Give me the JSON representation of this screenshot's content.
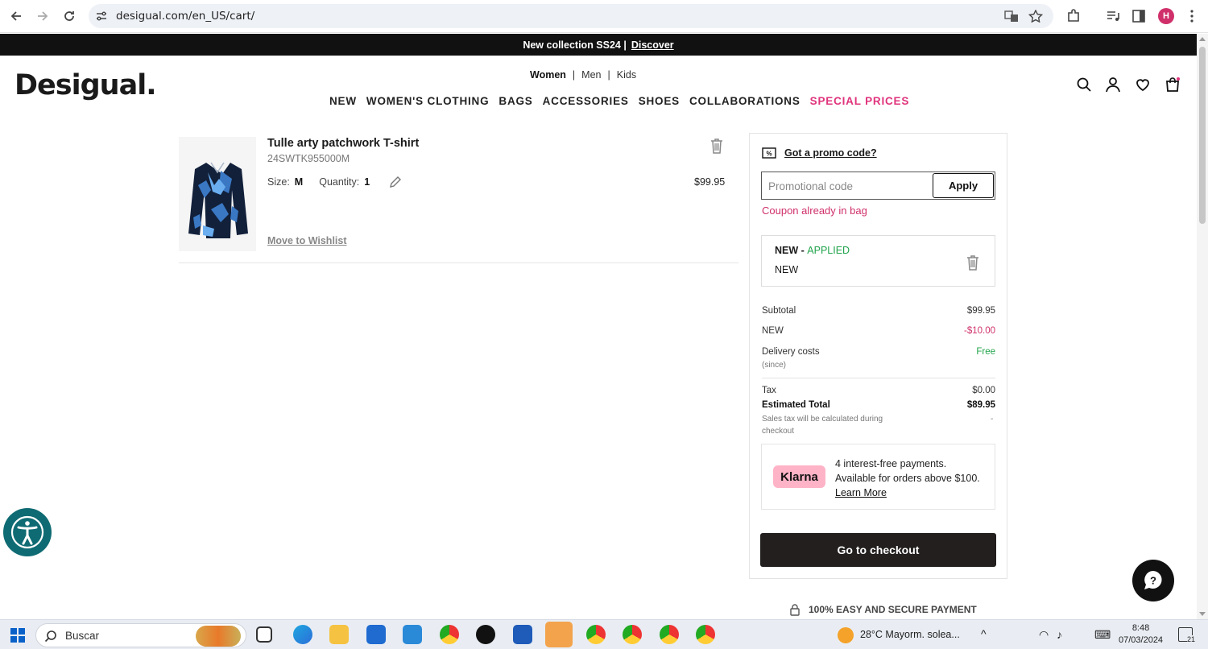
{
  "browser": {
    "url": "desigual.com/en_US/cart/",
    "profile_initial": "H"
  },
  "promo_bar": {
    "text": "New collection SS24 |",
    "link": "Discover"
  },
  "header": {
    "logo": "Desigual.",
    "gender_tabs": [
      {
        "label": "Women",
        "active": true
      },
      {
        "label": "Men",
        "active": false
      },
      {
        "label": "Kids",
        "active": false
      }
    ],
    "nav_items": [
      "NEW",
      "WOMEN'S CLOTHING",
      "BAGS",
      "ACCESSORIES",
      "SHOES",
      "COLLABORATIONS",
      "SPECIAL PRICES"
    ]
  },
  "cart_item": {
    "name": "Tulle arty patchwork T-shirt",
    "sku": "24SWTK955000M",
    "size_label": "Size:",
    "size_value": "M",
    "quantity_label": "Quantity:",
    "quantity_value": "1",
    "price": "$99.95",
    "wishlist_link": "Move to Wishlist"
  },
  "summary": {
    "promo_title": "Got a promo code?",
    "promo_placeholder": "Promotional code",
    "apply_label": "Apply",
    "coupon_message": "Coupon already in bag",
    "coupon_code": "NEW",
    "coupon_separator": " - ",
    "coupon_status": "APPLIED",
    "coupon_subtitle": "NEW",
    "subtotal_label": "Subtotal",
    "subtotal_value": "$99.95",
    "discount_label": "NEW",
    "discount_value": "-$10.00",
    "delivery_label": "Delivery costs",
    "delivery_note": "(since)",
    "delivery_value": "Free",
    "tax_label": "Tax",
    "tax_value": "$0.00",
    "total_label": "Estimated Total",
    "total_value": "$89.95",
    "total_note": "Sales tax will be calculated during checkout",
    "total_note_dash": "-",
    "klarna_logo": "Klarna",
    "klarna_line1": "4 interest-free payments.",
    "klarna_line2": "Available for orders above $100.",
    "klarna_link": "Learn More",
    "checkout_label": "Go to checkout",
    "secure_label": "100% EASY AND SECURE PAYMENT"
  },
  "taskbar": {
    "search_placeholder": "Buscar",
    "weather": "28°C  Mayorm. solea...",
    "time": "8:48",
    "date": "07/03/2024",
    "notif_count": "21"
  },
  "colors": {
    "accent_pink": "#e0337c",
    "applied_green": "#1fa34a",
    "checkout_bg": "#231f1f",
    "accessibility_teal": "#0e6b73"
  }
}
